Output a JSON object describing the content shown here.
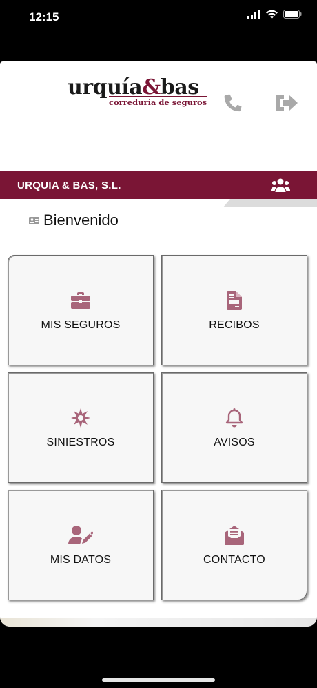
{
  "status": {
    "time": "12:15"
  },
  "header": {
    "logo_main_left": "urquía",
    "logo_amp": "&",
    "logo_main_right": "bas",
    "logo_sub": "correduría de seguros"
  },
  "company": {
    "name": "URQUIA & BAS, S.L."
  },
  "welcome": {
    "text": "Bienvenido"
  },
  "tiles": [
    {
      "label": "MIS SEGUROS",
      "icon": "briefcase-icon"
    },
    {
      "label": "RECIBOS",
      "icon": "document-icon"
    },
    {
      "label": "SINIESTROS",
      "icon": "burst-icon"
    },
    {
      "label": "AVISOS",
      "icon": "bell-icon"
    },
    {
      "label": "MIS DATOS",
      "icon": "user-edit-icon"
    },
    {
      "label": "CONTACTO",
      "icon": "envelope-open-icon"
    }
  ],
  "colors": {
    "brand": "#7a1535",
    "icon_tile": "#a8657a",
    "header_icons": "#a9a9a9"
  }
}
